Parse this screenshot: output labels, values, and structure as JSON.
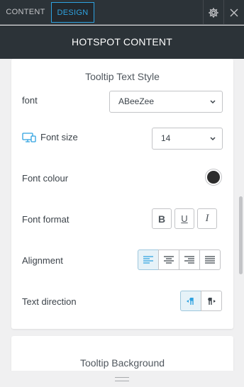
{
  "tabs": [
    {
      "label": "CONTENT",
      "active": false
    },
    {
      "label": "DESIGN",
      "active": true
    }
  ],
  "icons": {
    "settings": "gear-icon",
    "close": "close-icon"
  },
  "panel": {
    "title": "HOTSPOT CONTENT"
  },
  "tooltip_text_style": {
    "title": "Tooltip Text Style",
    "font": {
      "label": "font",
      "value": "ABeeZee"
    },
    "font_size": {
      "label": "Font size",
      "value": "14",
      "icon": "desktop-devices-icon"
    },
    "font_colour": {
      "label": "Font colour",
      "color": "#2c2c2c"
    },
    "font_format": {
      "label": "Font format",
      "buttons": [
        "B",
        "U",
        "I"
      ]
    },
    "alignment": {
      "label": "Alignment",
      "options": [
        "align-left",
        "align-center",
        "align-right",
        "align-justify"
      ],
      "selected": "align-left"
    },
    "text_direction": {
      "label": "Text direction",
      "options": [
        "ltr",
        "rtl"
      ],
      "selected": "ltr"
    }
  },
  "tooltip_background": {
    "title": "Tooltip Background"
  },
  "colors": {
    "accent": "#2ea2e0",
    "dark": "#2c3338"
  }
}
